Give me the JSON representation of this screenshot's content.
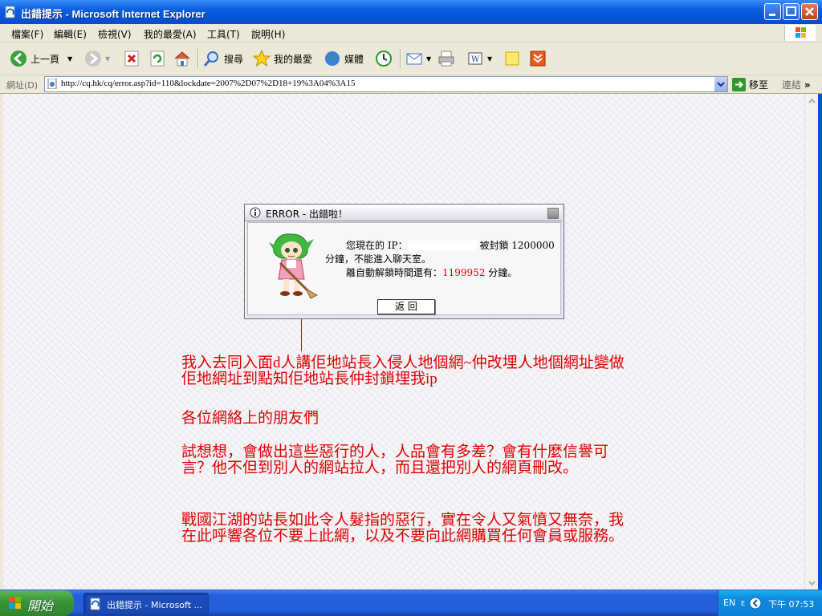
{
  "window": {
    "title": "出錯提示 - Microsoft Internet Explorer"
  },
  "menu": {
    "items": [
      "檔案(F)",
      "編輯(E)",
      "檢視(V)",
      "我的最愛(A)",
      "工具(T)",
      "說明(H)"
    ]
  },
  "toolbar": {
    "back_label": "上一頁",
    "search_label": "搜尋",
    "favorites_label": "我的最愛",
    "media_label": "媒體"
  },
  "address": {
    "label": "網址(D)",
    "url": "http://cq.hk/cq/error.asp?id=110&lockdate=2007%2D07%2D18+19%3A04%3A15",
    "go_label": "移至",
    "links_label": "連結"
  },
  "dialog": {
    "title": "ERROR - 出錯啦！",
    "ip_prefix": "您現在的 IP：",
    "lock_text": "被封鎖 1200000",
    "minutes_line": "分鐘，不能進入聊天室。",
    "remain_prefix": "離自動解鎖時間還有：",
    "remain_value": "1199952",
    "remain_suffix": "分鐘。",
    "back_button": "返 回"
  },
  "post": {
    "p1": "我入去同入面d人講佢地站長入侵人地個網~仲改埋人地個網址變做佢地網址到點知佢地站長仲封鎖埋我ip",
    "p2": "各位網絡上的朋友們",
    "p3": "試想想，會做出這些惡行的人，人品會有多差？會有什麼信譽可言？他不但到別人的網站拉人，而且還把別人的網頁刪改。",
    "p4": "戰國江湖的站長如此令人髮指的惡行，實在令人又氣憤又無奈，我在此呼響各位不要上此網，以及不要向此網購買任何會員或服務。"
  },
  "taskbar": {
    "start_label": "開始",
    "task_label": "出錯提示 - Microsoft ...",
    "lang": "EN",
    "clock": "下午 07:53"
  },
  "colors": {
    "post_text": "#e00000",
    "remain_value": "#d10000"
  }
}
